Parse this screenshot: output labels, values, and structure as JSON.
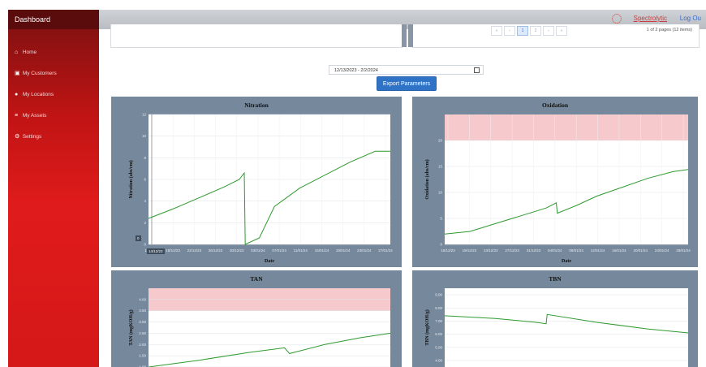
{
  "sidebar": {
    "title": "Dashboard",
    "items": [
      {
        "label": "Home",
        "icon": "home-icon"
      },
      {
        "label": "My Customers",
        "icon": "briefcase-icon"
      },
      {
        "label": "My Locations",
        "icon": "globe-icon"
      },
      {
        "label": "My Assets",
        "icon": "sliders-icon"
      },
      {
        "label": "Settings",
        "icon": "gear-icon"
      }
    ]
  },
  "topbar": {
    "brand": "Spectrolytic",
    "logout": "Log Ou"
  },
  "pager": {
    "buttons": [
      "«",
      "‹",
      "1",
      "2",
      "›",
      "»"
    ],
    "active": "1",
    "info": "1 of 2 pages (12 items)"
  },
  "date_range": {
    "value": "12/13/2023 - 2/2/2024"
  },
  "export": {
    "label": "Export Parameters"
  },
  "colors": {
    "line": "#2f9a2f",
    "band": "#f6c9cc",
    "card": "#76889c",
    "sidebar": "#d51818",
    "button": "#2f73c6"
  },
  "chart_data": [
    {
      "type": "line",
      "title": "Nitration",
      "xlabel": "Date",
      "ylabel": "Nitration (abs/cm)",
      "x_ticks": [
        "14/12/23",
        "18/12/23",
        "22/12/23",
        "26/12/23",
        "30/12/23",
        "03/01/24",
        "07/01/24",
        "11/01/24",
        "15/01/24",
        "19/01/24",
        "23/01/24",
        "27/01/24"
      ],
      "y_ticks": [
        "0",
        "2",
        "4",
        "6",
        "8",
        "10",
        "12"
      ],
      "ylim": [
        0,
        12
      ],
      "cursor": {
        "x_label": "14/12/23",
        "y_label": "0"
      },
      "series": [
        {
          "points": [
            [
              0,
              2.4
            ],
            [
              5,
              3.3
            ],
            [
              10,
              4.3
            ],
            [
              15,
              5.3
            ],
            [
              18,
              6.0
            ],
            [
              19,
              6.6
            ],
            [
              19.2,
              0
            ],
            [
              22,
              0.6
            ],
            [
              25,
              3.5
            ],
            [
              30,
              5.2
            ],
            [
              35,
              6.4
            ],
            [
              40,
              7.6
            ],
            [
              45,
              8.6
            ],
            [
              48,
              8.6
            ]
          ]
        }
      ]
    },
    {
      "type": "line",
      "title": "Oxidation",
      "xlabel": "Date",
      "ylabel": "Oxidation (abs/cm)",
      "x_ticks": [
        "15/12/23",
        "19/12/23",
        "23/12/23",
        "27/12/23",
        "31/12/23",
        "04/01/24",
        "08/01/24",
        "12/01/24",
        "16/01/24",
        "20/01/24",
        "24/01/24",
        "28/01/24"
      ],
      "y_ticks": [
        "0",
        "5",
        "10",
        "15",
        "20"
      ],
      "ylim": [
        0,
        25
      ],
      "threshold_band": [
        20,
        25
      ],
      "series": [
        {
          "points": [
            [
              0,
              2
            ],
            [
              5,
              2.5
            ],
            [
              10,
              4
            ],
            [
              15,
              5.5
            ],
            [
              20,
              7
            ],
            [
              22,
              8
            ],
            [
              22.2,
              6
            ],
            [
              26,
              7.5
            ],
            [
              30,
              9.3
            ],
            [
              35,
              11
            ],
            [
              40,
              12.7
            ],
            [
              45,
              14
            ],
            [
              48,
              14.4
            ]
          ]
        }
      ]
    },
    {
      "type": "line",
      "title": "TAN",
      "xlabel": "",
      "ylabel": "TAN (mgKOH/g)",
      "y_ticks": [
        "1.00",
        "1.50",
        "2.00",
        "2.50",
        "3.00",
        "3.50",
        "4.00"
      ],
      "ylim": [
        1.0,
        4.5
      ],
      "threshold_band": [
        3.5,
        4.5
      ],
      "series": [
        {
          "points": [
            [
              0,
              1.0
            ],
            [
              10,
              1.3
            ],
            [
              20,
              1.65
            ],
            [
              27,
              1.85
            ],
            [
              28,
              1.6
            ],
            [
              35,
              2.0
            ],
            [
              42,
              2.3
            ],
            [
              48,
              2.5
            ]
          ]
        }
      ]
    },
    {
      "type": "line",
      "title": "TBN",
      "xlabel": "",
      "ylabel": "TBN (mgKOH/g)",
      "y_ticks": [
        "4.00",
        "5.00",
        "6.00",
        "7.00",
        "8.00",
        "9.00"
      ],
      "ylim": [
        3.5,
        9.5
      ],
      "series": [
        {
          "points": [
            [
              0,
              7.4
            ],
            [
              10,
              7.2
            ],
            [
              18,
              6.9
            ],
            [
              20,
              6.8
            ],
            [
              20.2,
              7.5
            ],
            [
              30,
              6.9
            ],
            [
              40,
              6.4
            ],
            [
              48,
              6.1
            ]
          ]
        }
      ]
    }
  ]
}
